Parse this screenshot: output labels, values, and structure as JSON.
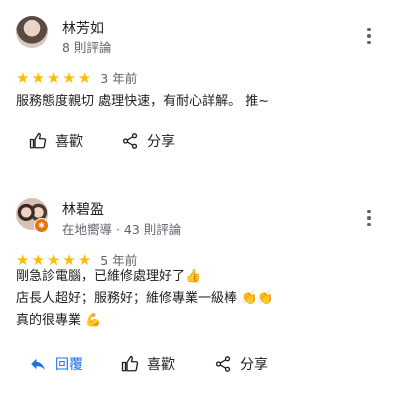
{
  "reviews": [
    {
      "name": "林芳如",
      "meta": "8 則評論",
      "rating": 5,
      "date": "3 年前",
      "text_lines": [
        "服務態度親切 處理快速，有耐心詳解。 推~"
      ]
    },
    {
      "name": "林碧盈",
      "meta": "在地嚮導 · 43 則評論",
      "rating": 5,
      "date": "5 年前",
      "text_lines": [
        "剛急診電腦，已維修處理好了👍",
        "店長人超好；服務好；維修專業一級棒 👏👏",
        "真的很專業 💪"
      ]
    }
  ],
  "actions": {
    "reply": "回覆",
    "like": "喜歡",
    "share": "分享"
  },
  "icons": {
    "more": "more-vert-icon",
    "like": "thumb-up-icon",
    "share": "share-icon",
    "reply": "reply-icon",
    "star": "star-icon",
    "local_guide": "local-guide-badge-icon"
  },
  "colors": {
    "star": "#fbbc04",
    "reply": "#1a73e8",
    "secondary_text": "#5f6368"
  }
}
